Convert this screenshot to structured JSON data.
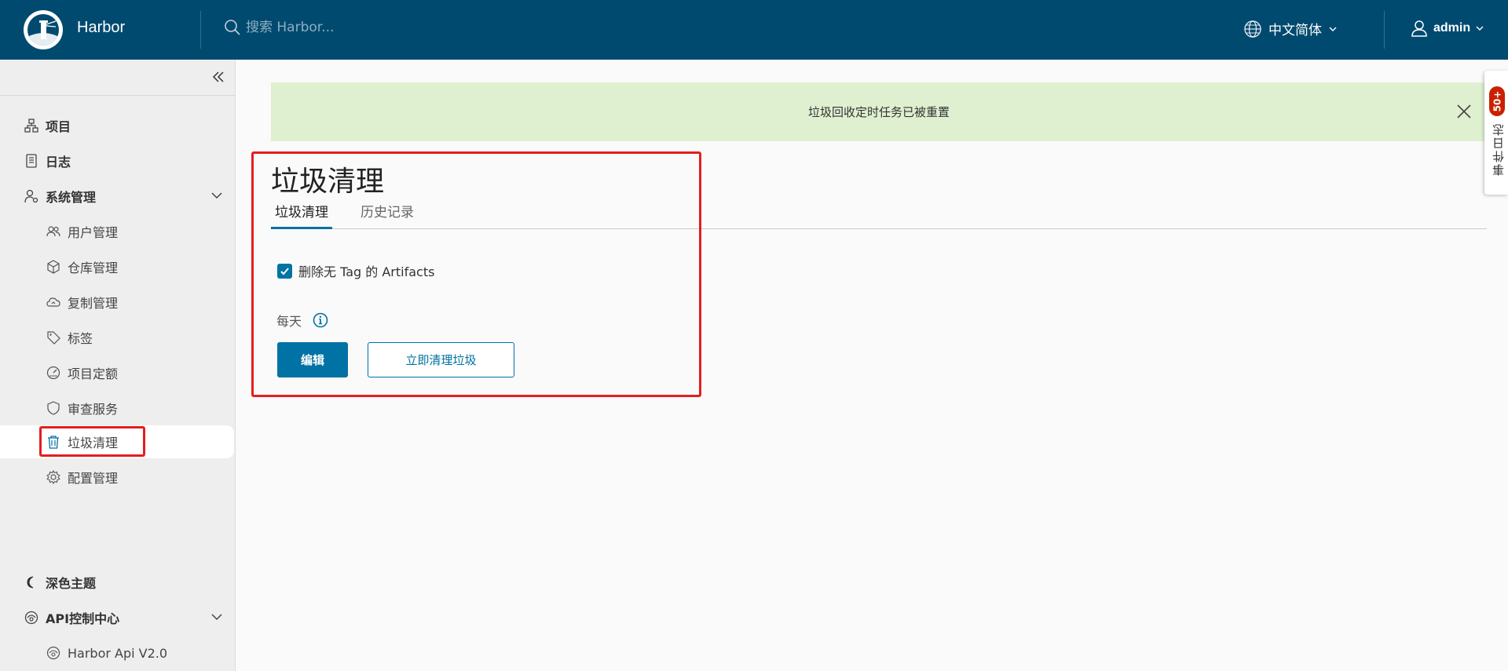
{
  "header": {
    "brand": "Harbor",
    "search_placeholder": "搜索 Harbor...",
    "language": "中文简体",
    "user": "admin"
  },
  "sidebar": {
    "items": [
      {
        "label": "项目",
        "icon": "project-icon"
      },
      {
        "label": "日志",
        "icon": "log-icon"
      },
      {
        "label": "系统管理",
        "icon": "admin-icon"
      },
      {
        "label": "用户管理",
        "icon": "users-icon"
      },
      {
        "label": "仓库管理",
        "icon": "registry-icon"
      },
      {
        "label": "复制管理",
        "icon": "replication-icon"
      },
      {
        "label": "标签",
        "icon": "tag-icon"
      },
      {
        "label": "项目定额",
        "icon": "quota-icon"
      },
      {
        "label": "审查服务",
        "icon": "shield-icon"
      },
      {
        "label": "垃圾清理",
        "icon": "trash-icon"
      },
      {
        "label": "配置管理",
        "icon": "gear-icon"
      }
    ],
    "bottom": [
      {
        "label": "深色主题",
        "icon": "moon-icon"
      },
      {
        "label": "API控制中心",
        "icon": "api-icon"
      },
      {
        "label": "Harbor Api V2.0",
        "icon": "api-icon"
      }
    ]
  },
  "banner": {
    "message": "垃圾回收定时任务已被重置"
  },
  "main": {
    "title": "垃圾清理",
    "tabs": [
      {
        "label": "垃圾清理",
        "active": true
      },
      {
        "label": "历史记录",
        "active": false
      }
    ],
    "checkbox_label": "删除无 Tag 的 Artifacts",
    "checkbox_checked": true,
    "schedule": "每天",
    "edit_button": "编辑",
    "gc_now_button": "立即清理垃圾"
  },
  "event_panel": {
    "badge": "50+",
    "label": "事件日志"
  },
  "colors": {
    "header_bg": "#004a70",
    "primary": "#0072a3",
    "banner_bg": "#dff0d0",
    "highlight": "#e41e1e"
  }
}
